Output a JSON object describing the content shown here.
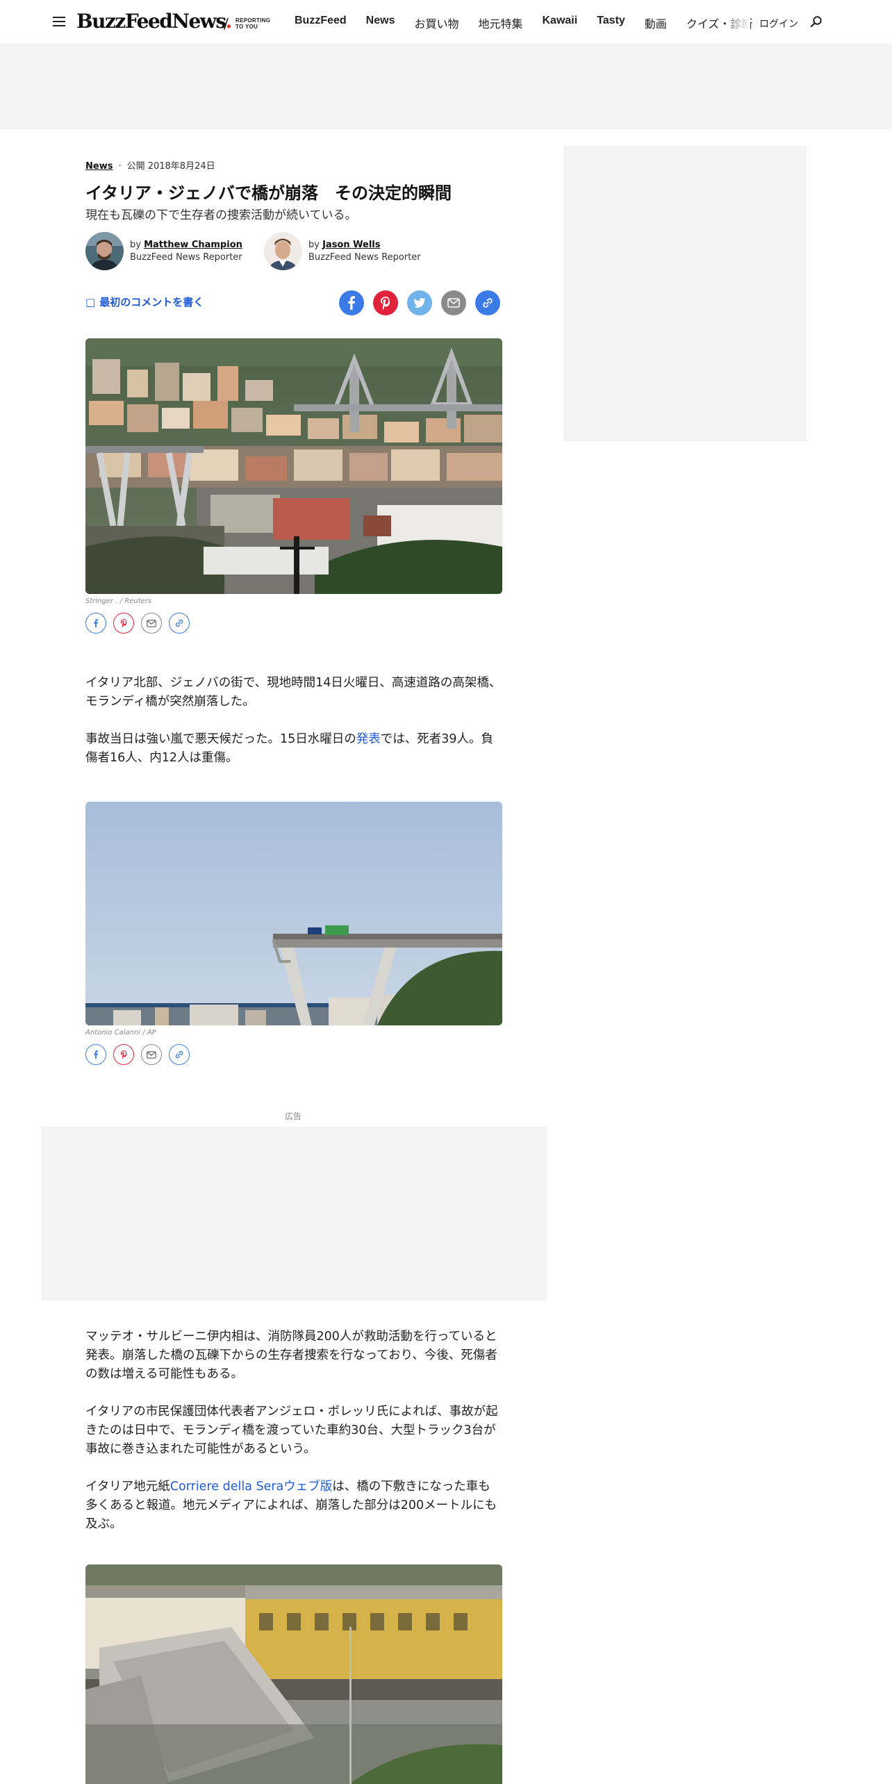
{
  "header": {
    "logo": {
      "text_main": "BuzzFeed",
      "text_news": "News",
      "dot": "."
    },
    "tagline": "REPORTING\nTO YOU",
    "nav": [
      {
        "label": "BuzzFeed",
        "bold": true
      },
      {
        "label": "News",
        "bold": true
      },
      {
        "label": "お買い物",
        "bold": false
      },
      {
        "label": "地元特集",
        "bold": false
      },
      {
        "label": "Kawaii",
        "bold": true
      },
      {
        "label": "Tasty",
        "bold": true
      },
      {
        "label": "動画",
        "bold": false
      },
      {
        "label": "クイズ・診断",
        "bold": false
      }
    ],
    "login": "ログイン",
    "icons": {
      "menu": "hamburger-icon",
      "search": "search-icon"
    }
  },
  "article": {
    "category": "News",
    "published": "公開 2018年8月24日",
    "title": "イタリア・ジェノバで橋が崩落　その決定的瞬間",
    "dek": "現在も瓦礫の下で生存者の捜索活動が続いている。",
    "authors": [
      {
        "by": "by ",
        "name": "Matthew Champion",
        "role": "BuzzFeed News Reporter"
      },
      {
        "by": "by ",
        "name": "Jason Wells",
        "role": "BuzzFeed News Reporter"
      }
    ],
    "comment_link": "最初のコメントを書く",
    "comment_icon": "comment-icon",
    "share_icons": [
      "facebook-icon",
      "pinterest-icon",
      "twitter-icon",
      "email-icon",
      "link-icon"
    ],
    "photos": [
      {
        "credit": "Stringer . / Reuters"
      },
      {
        "credit": "Antonio Calanni / AP"
      }
    ],
    "paragraphs": {
      "p1": "イタリア北部、ジェノバの街で、現地時間14日火曜日、高速道路の高架橋、モランディ橋が突然崩落した。",
      "p2_before": "事故当日は強い嵐で悪天候だった。15日水曜日の",
      "p2_link": "発表",
      "p2_after": "では、死者39人。負傷者16人、内12人は重傷。",
      "p3": "マッテオ・サルビーニ伊内相は、消防隊員200人が救助活動を行っていると発表。崩落した橋の瓦礫下からの生存者捜索を行なっており、今後、死傷者の数は増える可能性もある。",
      "p4": "イタリアの市民保護団体代表者アンジェロ・ボレッリ氏によれば、事故が起きたのは日中で、モランディ橋を渡っていた車約30台、大型トラック3台が事故に巻き込まれた可能性があるという。",
      "p5_before": "イタリア地元紙",
      "p5_link": "Corriere della Seraウェブ版",
      "p5_after": "は、橋の下敷きになった車も多くあると報道。地元メディアによれば、崩落した部分は200メートルにも及ぶ。"
    }
  },
  "ads": {
    "label": "広告"
  },
  "colors": {
    "link": "#1d5bd8",
    "facebook": "#3b7be8",
    "pinterest": "#e0233b",
    "twitter": "#6fb3ea",
    "email": "#8a8a8a",
    "copy_link": "#3b7be8",
    "ad_placeholder": "#f3f3f3"
  }
}
